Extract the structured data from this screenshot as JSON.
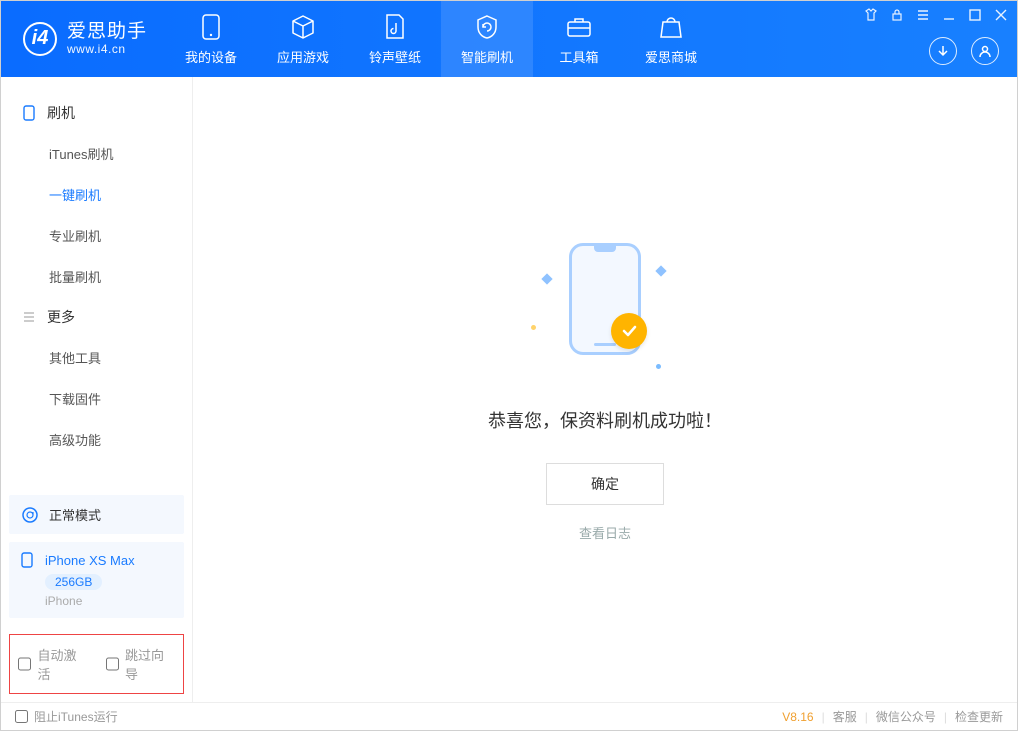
{
  "app": {
    "name": "爱思助手",
    "url": "www.i4.cn"
  },
  "nav": {
    "items": [
      {
        "label": "我的设备"
      },
      {
        "label": "应用游戏"
      },
      {
        "label": "铃声壁纸"
      },
      {
        "label": "智能刷机"
      },
      {
        "label": "工具箱"
      },
      {
        "label": "爱思商城"
      }
    ]
  },
  "sidebar": {
    "group1": {
      "title": "刷机",
      "items": [
        "iTunes刷机",
        "一键刷机",
        "专业刷机",
        "批量刷机"
      ]
    },
    "group2": {
      "title": "更多",
      "items": [
        "其他工具",
        "下载固件",
        "高级功能"
      ]
    },
    "status": "正常模式",
    "device": {
      "name": "iPhone XS Max",
      "storage": "256GB",
      "type": "iPhone"
    },
    "checks": {
      "auto_activate": "自动激活",
      "skip_guide": "跳过向导"
    }
  },
  "main": {
    "success": "恭喜您，保资料刷机成功啦！",
    "ok": "确定",
    "view_log": "查看日志"
  },
  "statusbar": {
    "block_itunes": "阻止iTunes运行",
    "version": "V8.16",
    "support": "客服",
    "wechat": "微信公众号",
    "update": "检查更新"
  }
}
